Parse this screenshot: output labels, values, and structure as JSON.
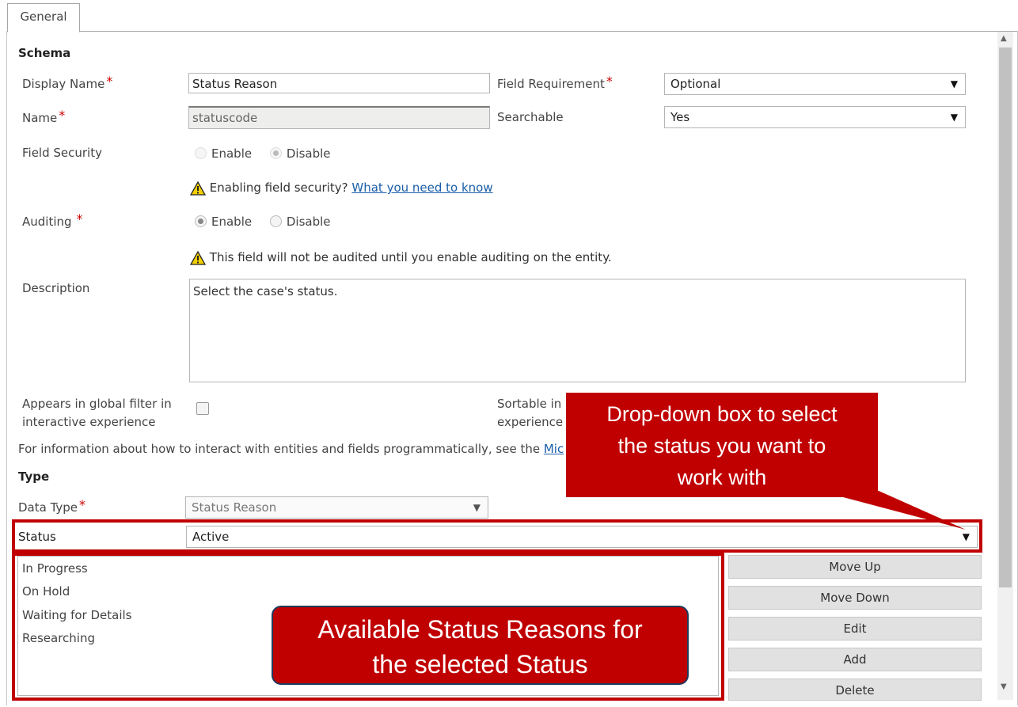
{
  "tabs": [
    {
      "label": "General"
    }
  ],
  "schema": {
    "heading": "Schema",
    "display_name": {
      "label": "Display Name",
      "value": "Status Reason"
    },
    "name": {
      "label": "Name",
      "value": "statuscode"
    },
    "field_requirement": {
      "label": "Field Requirement",
      "value": "Optional"
    },
    "searchable": {
      "label": "Searchable",
      "value": "Yes"
    },
    "field_security": {
      "label": "Field Security",
      "options": [
        "Enable",
        "Disable"
      ],
      "selected": "Disable",
      "warning_text": "Enabling field security?",
      "warning_link": "What you need to know"
    },
    "auditing": {
      "label": "Auditing",
      "options": [
        "Enable",
        "Disable"
      ],
      "selected": "Enable",
      "warning_text": "This field will not be audited until you enable auditing on the entity."
    },
    "description": {
      "label": "Description",
      "value": "Select the case's status."
    },
    "global_filter": {
      "label_line1": "Appears in global filter in",
      "label_line2": "interactive experience",
      "checked": false
    },
    "sortable": {
      "label_line1": "Sortable in",
      "label_line2": "experience"
    },
    "info_text": "For information about how to interact with entities and fields programmatically, see the",
    "info_link": "Mic"
  },
  "type": {
    "heading": "Type",
    "data_type": {
      "label": "Data Type",
      "value": "Status Reason"
    },
    "status": {
      "label": "Status",
      "value": "Active"
    },
    "reasons": [
      "In Progress",
      "On Hold",
      "Waiting for Details",
      "Researching"
    ],
    "buttons": {
      "move_up": "Move Up",
      "move_down": "Move Down",
      "edit": "Edit",
      "add": "Add",
      "delete": "Delete"
    }
  },
  "callouts": {
    "dropdown": [
      "Drop-down box to select",
      "the status you want to",
      "work with"
    ],
    "reasons": [
      "Available Status Reasons for",
      "the selected Status"
    ]
  },
  "colors": {
    "callout": "#c00000",
    "link": "#1a5ea8",
    "required": "#cc0000"
  }
}
